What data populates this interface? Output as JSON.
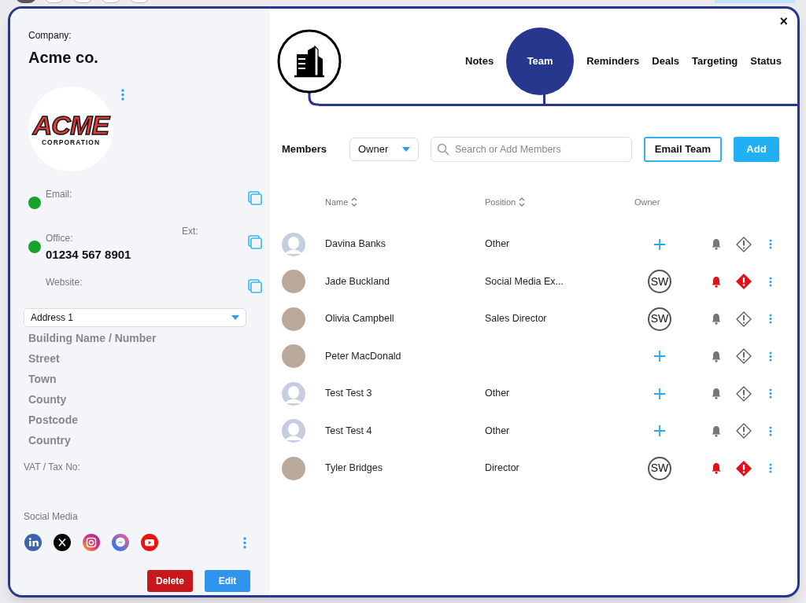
{
  "company": {
    "label": "Company:",
    "name": "Acme co.",
    "logo": {
      "word": "ACME",
      "subword": "CORPORATION"
    }
  },
  "contacts": [
    {
      "label": "Email:",
      "color": "#16a32a"
    },
    {
      "label": "Office:",
      "value": "01234 567 8901",
      "ext_label": "Ext:",
      "color": "#16a32a"
    },
    {
      "label": "Website:"
    }
  ],
  "address": {
    "select": "Address 1",
    "lines": [
      "Building Name / Number",
      "Street",
      "Town",
      "County",
      "Postcode",
      "Country"
    ]
  },
  "vat_label": "VAT / Tax No:",
  "social_media": {
    "label": "Social Media",
    "icons": [
      {
        "kind": "linkedin"
      },
      {
        "kind": "x"
      },
      {
        "kind": "instagram"
      },
      {
        "kind": "messenger"
      },
      {
        "kind": "youtube"
      }
    ]
  },
  "actions": [
    "Delete",
    "Edit"
  ],
  "close": "×",
  "tabs": [
    {
      "label": "Notes",
      "selected": false
    },
    {
      "label": "Team",
      "selected": true
    },
    {
      "label": "Reminders",
      "selected": false
    },
    {
      "label": "Deals",
      "selected": false
    },
    {
      "label": "Targeting",
      "selected": false
    },
    {
      "label": "Status",
      "selected": false
    }
  ],
  "toolbar": {
    "label": "Members",
    "filter": "Owner",
    "search_placeholder": "Search or Add Members",
    "email_button": "Email Team",
    "add_button": "Add"
  },
  "table": {
    "columns": [
      "Name",
      "Position",
      "Owner"
    ],
    "rows": [
      {
        "kind": "silhouette",
        "name": "Davina Banks",
        "position": "Other",
        "owner": null,
        "alerted": false
      },
      {
        "kind": "photo",
        "name": "Jade Buckland",
        "position": "Social Media Ex...",
        "owner": "SW",
        "alerted": true
      },
      {
        "kind": "photo",
        "name": "Olivia Campbell",
        "position": "Sales Director",
        "owner": "SW",
        "alerted": false
      },
      {
        "kind": "photo",
        "name": "Peter MacDonald",
        "owner": null,
        "alerted": false
      },
      {
        "kind": "silhouette",
        "name": "Test Test 3",
        "position": "Other",
        "owner": null,
        "alerted": false
      },
      {
        "kind": "silhouette",
        "name": "Test Test 4",
        "position": "Other",
        "owner": null,
        "alerted": false
      },
      {
        "kind": "photo",
        "name": "Tyler Bridges",
        "position": "Director",
        "owner": "SW",
        "alerted": true
      }
    ]
  }
}
